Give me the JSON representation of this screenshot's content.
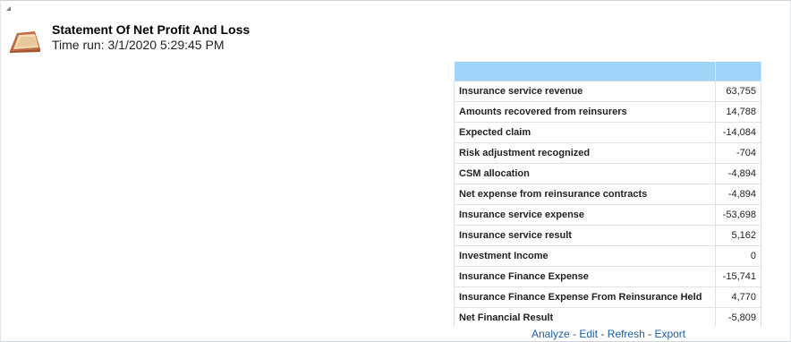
{
  "report": {
    "title": "Statement Of Net Profit And Loss",
    "time_run": "Time run: 3/1/2020 5:29:45 PM"
  },
  "table": {
    "header": [
      "",
      ""
    ],
    "rows": [
      {
        "label": "Insurance service revenue",
        "value": "63,755"
      },
      {
        "label": "Amounts recovered from reinsurers",
        "value": "14,788"
      },
      {
        "label": "Expected claim",
        "value": "-14,084"
      },
      {
        "label": "Risk adjustment recognized",
        "value": "-704"
      },
      {
        "label": "CSM allocation",
        "value": "-4,894"
      },
      {
        "label": "Net expense from reinsurance contracts",
        "value": "-4,894"
      },
      {
        "label": "Insurance service expense",
        "value": "-53,698"
      },
      {
        "label": "Insurance service result",
        "value": "5,162"
      },
      {
        "label": "Investment Income",
        "value": "0"
      },
      {
        "label": "Insurance Finance Expense",
        "value": "-15,741"
      },
      {
        "label": "Insurance Finance Expense From Reinsurance Held",
        "value": "4,770"
      },
      {
        "label": "Net Financial Result",
        "value": "-5,809"
      }
    ]
  },
  "links": {
    "analyze": "Analyze",
    "edit": "Edit",
    "refresh": "Refresh",
    "export": "Export",
    "separator": " - "
  },
  "icons": {
    "collapse": "collapse-triangle-icon",
    "report": "report-icon"
  },
  "colors": {
    "header_bg": "#9ed4f5",
    "link": "#1c5d9e"
  }
}
